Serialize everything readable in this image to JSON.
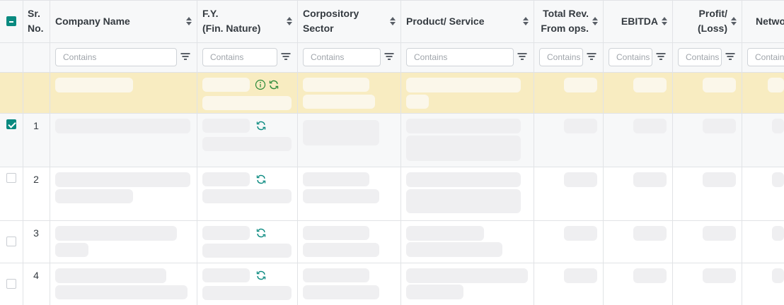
{
  "table": {
    "columns": [
      {
        "key": "sr_no",
        "label_line1": "Sr.",
        "label_line2": "No."
      },
      {
        "key": "company_name",
        "label": "Company Name"
      },
      {
        "key": "fy",
        "label_line1": "F.Y.",
        "label_line2": "(Fin. Nature)"
      },
      {
        "key": "sector",
        "label": "Corpository Sector"
      },
      {
        "key": "product",
        "label": "Product/ Service"
      },
      {
        "key": "total_rev",
        "label_line1": "Total Rev.",
        "label_line2": "From ops."
      },
      {
        "key": "ebitda",
        "label": "EBITDA"
      },
      {
        "key": "profit",
        "label_line1": "Profit/",
        "label_line2": "(Loss)"
      },
      {
        "key": "networth",
        "label": "Netwo"
      }
    ],
    "filter_placeholder": "Contains",
    "filter_placeholder_short": "Contain",
    "rows": [
      {
        "sr": "1",
        "checked": true
      },
      {
        "sr": "2",
        "checked": false
      },
      {
        "sr": "3",
        "checked": false
      },
      {
        "sr": "4",
        "checked": false
      }
    ],
    "select_all_state": "indeterminate"
  },
  "colors": {
    "accent": "#0a8a80",
    "highlight_row": "#f8ecc1",
    "header_bg": "#f7f8f9",
    "skeleton": "#efeff1",
    "grid_line": "#e1e3e6"
  },
  "icons": {
    "sort": "sort-icon",
    "filter": "filter-icon",
    "info": "info-icon",
    "refresh": "refresh-icon"
  }
}
